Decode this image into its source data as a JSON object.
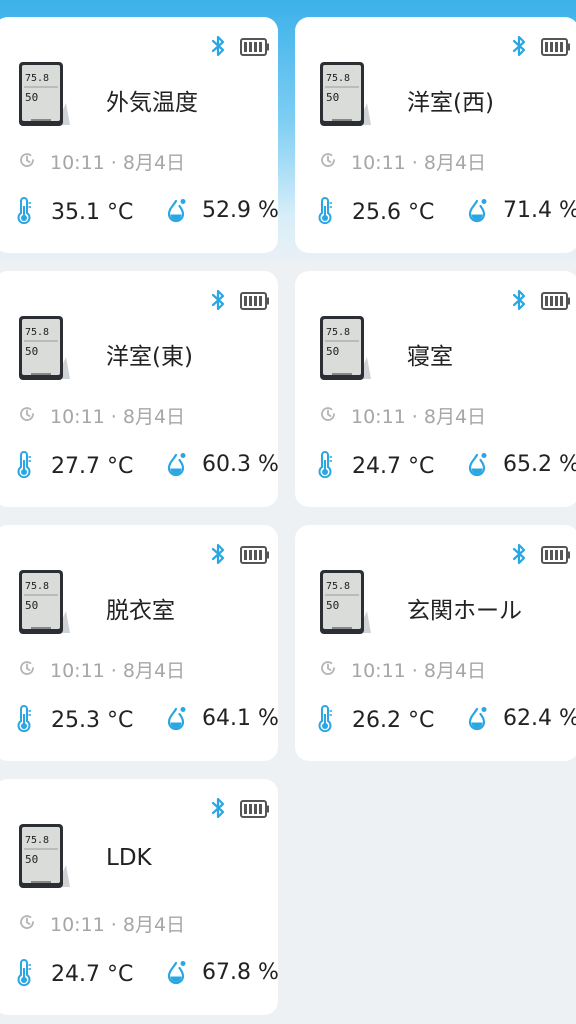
{
  "colors": {
    "accent": "#2aa7e3",
    "card_bg": "#ffffff",
    "page_bg": "#eef1f4",
    "muted_text": "#a6a6a6",
    "text": "#222222"
  },
  "sensors": [
    {
      "name": "外気温度",
      "time": "10:11 · 8月4日",
      "temperature": "35.1 °C",
      "humidity": "52.9 %"
    },
    {
      "name": "洋室(西)",
      "time": "10:11 · 8月4日",
      "temperature": "25.6 °C",
      "humidity": "71.4 %"
    },
    {
      "name": "洋室(東)",
      "time": "10:11 · 8月4日",
      "temperature": "27.7 °C",
      "humidity": "60.3 %"
    },
    {
      "name": "寝室",
      "time": "10:11 · 8月4日",
      "temperature": "24.7 °C",
      "humidity": "65.2 %"
    },
    {
      "name": "脱衣室",
      "time": "10:11 · 8月4日",
      "temperature": "25.3 °C",
      "humidity": "64.1 %"
    },
    {
      "name": "玄関ホール",
      "time": "10:11 · 8月4日",
      "temperature": "26.2 °C",
      "humidity": "62.4 %"
    },
    {
      "name": "LDK",
      "time": "10:11 · 8月4日",
      "temperature": "24.7 °C",
      "humidity": "67.8 %"
    }
  ],
  "icons": {
    "status": [
      "bluetooth-icon",
      "battery-full-icon"
    ],
    "rows": [
      "clock-icon",
      "thermometer-icon",
      "humidity-drop-icon"
    ],
    "device": "thermo-hygrometer-device-image"
  }
}
